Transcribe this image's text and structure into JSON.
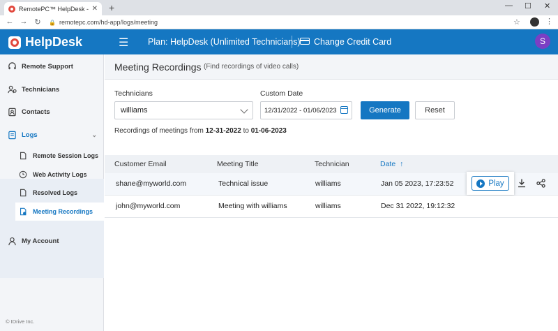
{
  "browser": {
    "tab_title": "RemotePC™ HelpDesk - Web Act",
    "tab_close": "✕",
    "new_tab": "+",
    "url": "remotepc.com/hd-app/logs/meeting",
    "min": "—",
    "max": "☐",
    "close": "✕"
  },
  "header": {
    "brand": "HelpDesk",
    "plan": "Plan: HelpDesk (Unlimited Technicians)",
    "change_card": "Change Credit Card",
    "avatar_letter": "S",
    "accent": "#1577c2"
  },
  "sidebar": {
    "items": [
      {
        "label": "Remote Support",
        "icon": "headset-icon"
      },
      {
        "label": "Technicians",
        "icon": "technicians-icon"
      },
      {
        "label": "Contacts",
        "icon": "contacts-icon"
      },
      {
        "label": "Logs",
        "icon": "logs-icon"
      },
      {
        "label": "Remote Session Logs",
        "icon": "document-icon"
      },
      {
        "label": "Web Activity Logs",
        "icon": "clock-icon"
      },
      {
        "label": "Resolved Logs",
        "icon": "document-icon"
      },
      {
        "label": "Meeting Recordings",
        "icon": "recording-icon"
      },
      {
        "label": "My Account",
        "icon": "user-icon"
      }
    ],
    "copyright": "© IDrive Inc."
  },
  "page": {
    "title": "Meeting Recordings",
    "subtitle": "(Find recordings of video calls)",
    "technicians_label": "Technicians",
    "technician_value": "williams",
    "custom_date_label": "Custom Date",
    "date_range_value": "12/31/2022 - 01/06/2023",
    "generate_label": "Generate",
    "reset_label": "Reset",
    "range_prefix": "Recordings of meetings from",
    "range_from": "12-31-2022",
    "range_to_word": "to",
    "range_to": "01-06-2023"
  },
  "table": {
    "columns": [
      "Customer Email",
      "Meeting Title",
      "Technician",
      "Date"
    ],
    "sort_arrow": "↑",
    "rows": [
      {
        "email": "shane@myworld.com",
        "title": "Technical issue",
        "technician": "williams",
        "date": "Jan 05 2023, 17:23:52"
      },
      {
        "email": "john@myworld.com",
        "title": "Meeting with williams",
        "technician": "williams",
        "date": "Dec 31 2022, 19:12:32"
      }
    ],
    "play_label": "Play"
  }
}
